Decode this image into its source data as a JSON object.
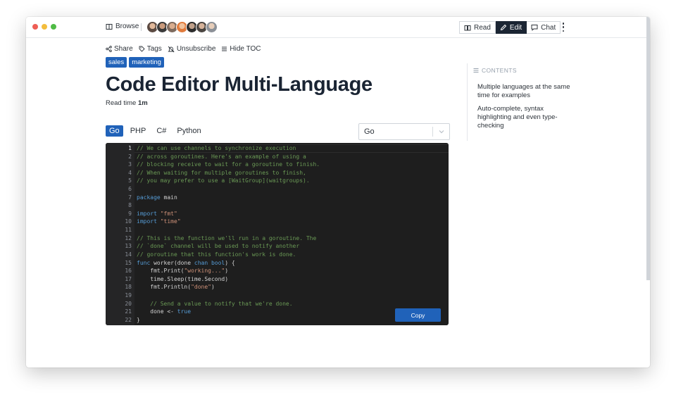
{
  "topbar": {
    "browse_label": "Browse",
    "avatar_count": 7,
    "modes": [
      {
        "label": "Read",
        "icon": "book-icon",
        "active": false
      },
      {
        "label": "Edit",
        "icon": "pencil-icon",
        "active": true
      },
      {
        "label": "Chat",
        "icon": "chat-icon",
        "active": false
      }
    ]
  },
  "actions": {
    "share": "Share",
    "tags": "Tags",
    "unsubscribe": "Unsubscribe",
    "hide_toc": "Hide TOC"
  },
  "tags": [
    "sales",
    "marketing"
  ],
  "page": {
    "title": "Code Editor Multi-Language",
    "read_time_label": "Read time",
    "read_time_value": "1m"
  },
  "editor": {
    "tabs": [
      "Go",
      "PHP",
      "C#",
      "Python"
    ],
    "active_tab": "Go",
    "select_value": "Go",
    "copy_label": "Copy",
    "active_line": 1,
    "lines": [
      [
        [
          "cm",
          "// We can use channels to synchronize execution"
        ]
      ],
      [
        [
          "cm",
          "// across goroutines. Here's an example of using a"
        ]
      ],
      [
        [
          "cm",
          "// blocking receive to wait for a goroutine to finish."
        ]
      ],
      [
        [
          "cm",
          "// When waiting for multiple goroutines to finish,"
        ]
      ],
      [
        [
          "cm",
          "// you may prefer to use a [WaitGroup](waitgroups)."
        ]
      ],
      [],
      [
        [
          "kw",
          "package"
        ],
        [
          "pl",
          " main"
        ]
      ],
      [],
      [
        [
          "kw",
          "import"
        ],
        [
          "pl",
          " "
        ],
        [
          "str",
          "\"fmt\""
        ]
      ],
      [
        [
          "kw",
          "import"
        ],
        [
          "pl",
          " "
        ],
        [
          "str",
          "\"time\""
        ]
      ],
      [],
      [
        [
          "cm",
          "// This is the function we'll run in a goroutine. The"
        ]
      ],
      [
        [
          "cm",
          "// `done` channel will be used to notify another"
        ]
      ],
      [
        [
          "cm",
          "// goroutine that this function's work is done."
        ]
      ],
      [
        [
          "kw",
          "func"
        ],
        [
          "pl",
          " worker(done "
        ],
        [
          "kw",
          "chan"
        ],
        [
          "pl",
          " "
        ],
        [
          "kw",
          "bool"
        ],
        [
          "pl",
          ") {"
        ]
      ],
      [
        [
          "pl",
          "    fmt.Print("
        ],
        [
          "str",
          "\"working...\""
        ],
        [
          "pl",
          ")"
        ]
      ],
      [
        [
          "pl",
          "    time.Sleep(time.Second)"
        ]
      ],
      [
        [
          "pl",
          "    fmt.Println("
        ],
        [
          "str",
          "\"done\""
        ],
        [
          "pl",
          ")"
        ]
      ],
      [],
      [
        [
          "pl",
          "    "
        ],
        [
          "cm",
          "// Send a value to notify that we're done."
        ]
      ],
      [
        [
          "pl",
          "    done <- "
        ],
        [
          "kw",
          "true"
        ]
      ],
      [
        [
          "pl",
          "}"
        ]
      ]
    ]
  },
  "toc": {
    "heading": "CONTENTS",
    "items": [
      "Multiple languages at the same time for examples",
      "Auto-complete, syntax highlighting and even type-checking"
    ]
  },
  "colors": {
    "accent": "#2062b9",
    "title": "#1a2433",
    "editor_bg": "#1e1e1e",
    "comment": "#6a9955",
    "keyword": "#569cd6",
    "string": "#ce9178"
  }
}
